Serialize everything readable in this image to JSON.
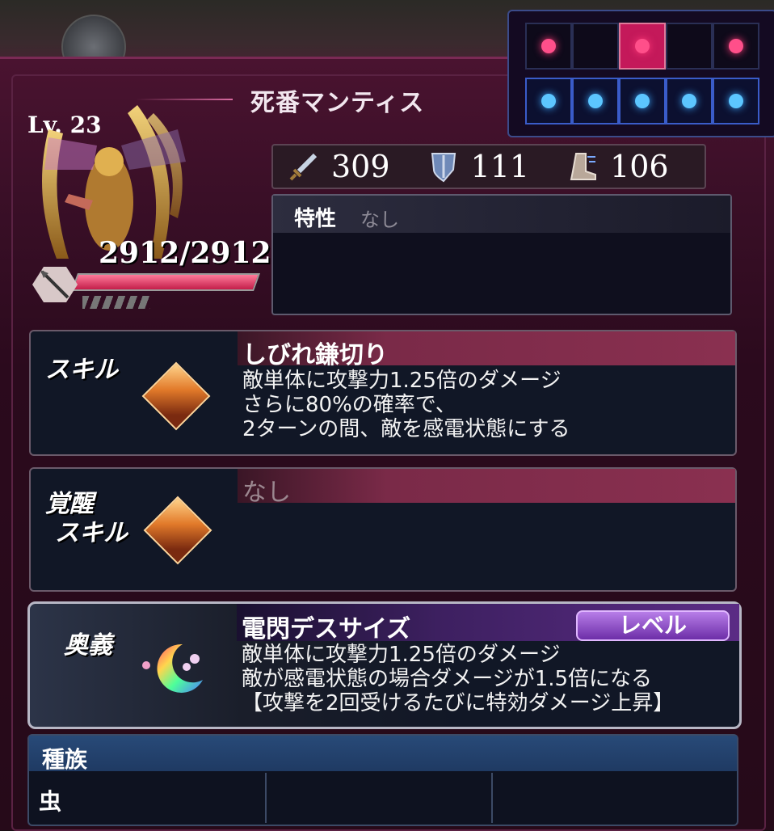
{
  "monster": {
    "name": "死番マンティス",
    "level": "Lv. 23",
    "hp": "2912/2912",
    "hp_fill_fraction": 1.0
  },
  "stats": {
    "attack": "309",
    "defense": "111",
    "speed": "106",
    "attack_icon": "sword-icon",
    "defense_icon": "shield-icon",
    "speed_icon": "boot-icon"
  },
  "trait": {
    "label": "特性",
    "value": "なし"
  },
  "skill": {
    "label": "スキル",
    "name": "しびれ鎌切り",
    "description": "敵単体に攻撃力1.25倍のダメージ\nさらに80%の確率で、\n2ターンの間、敵を感電状態にする"
  },
  "awaken_skill": {
    "label_line1": "覚醒",
    "label_line2": "スキル",
    "name": "なし"
  },
  "ougi": {
    "label": "奥義",
    "name": "電閃デスサイズ",
    "level_button": "レベル",
    "description": "敵単体に攻撃力1.25倍のダメージ\n敵が感電状態の場合ダメージが1.5倍になる\n【攻撃を2回受けるたびに特効ダメージ上昇】"
  },
  "race": {
    "header": "種族",
    "values": [
      "虫",
      "",
      ""
    ]
  },
  "grid": {
    "top_row": [
      "pink",
      "empty",
      "pink-active",
      "empty",
      "pink"
    ],
    "bottom_row": [
      "blue",
      "blue",
      "blue",
      "blue",
      "blue"
    ]
  },
  "colors": {
    "accent_pink": "#c4195a",
    "panel": "#2b0a1d",
    "level_button": "#8a4fc8"
  }
}
